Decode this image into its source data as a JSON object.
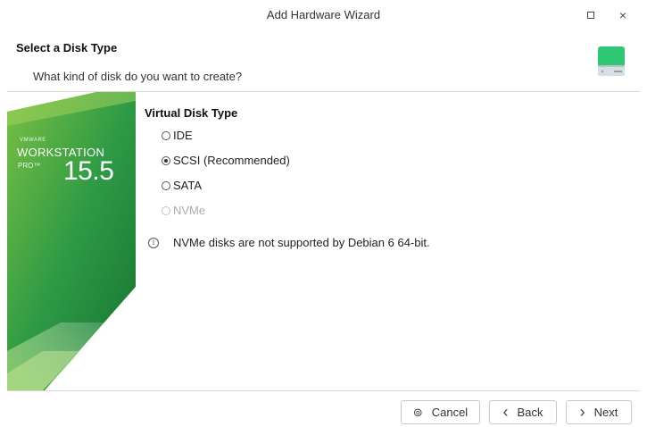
{
  "window": {
    "title": "Add Hardware Wizard",
    "maximize_icon": "maximize-icon",
    "close_glyph": "×"
  },
  "header": {
    "title": "Select a Disk Type",
    "subtitle": "What kind of disk do you want to create?"
  },
  "banner": {
    "vendor": "VMWARE",
    "product": "WORKSTATION",
    "edition": "PRO™",
    "version": "15.5",
    "colors": {
      "green_dark": "#1e7a35",
      "green_light": "#7cc143"
    }
  },
  "disk_type": {
    "section_title": "Virtual Disk Type",
    "options": [
      {
        "label": "IDE",
        "selected": false,
        "enabled": true
      },
      {
        "label": "SCSI (Recommended)",
        "selected": true,
        "enabled": true
      },
      {
        "label": "SATA",
        "selected": false,
        "enabled": true
      },
      {
        "label": "NVMe",
        "selected": false,
        "enabled": false
      }
    ],
    "info_glyph": "i",
    "info_text": "NVMe disks are not supported by Debian 6 64-bit."
  },
  "buttons": {
    "cancel": {
      "label": "Cancel",
      "icon": "cancel-icon",
      "glyph": "⊚"
    },
    "back": {
      "label": "Back",
      "icon": "chevron-left-icon",
      "glyph": "‹"
    },
    "next": {
      "label": "Next",
      "icon": "chevron-right-icon",
      "glyph": "›"
    }
  }
}
